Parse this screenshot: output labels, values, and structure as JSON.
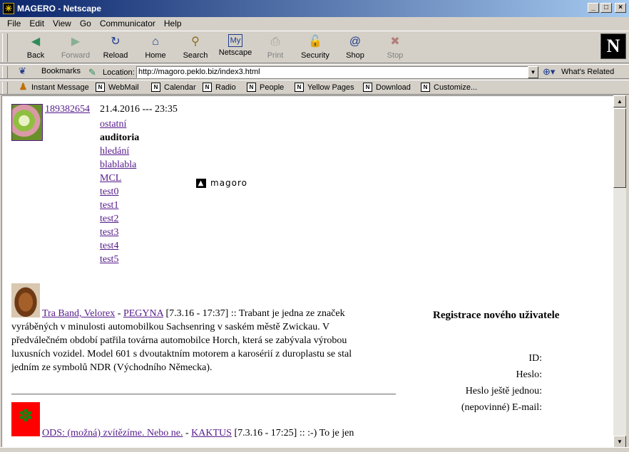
{
  "window": {
    "title": "MAGERO - Netscape",
    "buttons": {
      "minimize": "_",
      "maximize": "□",
      "close": "×"
    }
  },
  "menu": [
    "File",
    "Edit",
    "View",
    "Go",
    "Communicator",
    "Help"
  ],
  "toolbar": {
    "buttons": [
      {
        "label": "Back",
        "icon": "back-arrow-icon",
        "glyph": "◀",
        "color": "#2e8b57",
        "enabled": true
      },
      {
        "label": "Forward",
        "icon": "forward-arrow-icon",
        "glyph": "▶",
        "color": "#2e8b57",
        "enabled": false
      },
      {
        "label": "Reload",
        "icon": "reload-icon",
        "glyph": "↻",
        "color": "#1e3c8c",
        "enabled": true
      },
      {
        "label": "Home",
        "icon": "home-icon",
        "glyph": "⌂",
        "color": "#1e3c8c",
        "enabled": true
      },
      {
        "label": "Search",
        "icon": "search-icon",
        "glyph": "⚲",
        "color": "#8c6e1e",
        "enabled": true
      },
      {
        "label": "Netscape",
        "icon": "my-netscape-icon",
        "glyph": "My",
        "color": "#1e3c8c",
        "enabled": true
      },
      {
        "label": "Print",
        "icon": "print-icon",
        "glyph": "⎙",
        "color": "#555555",
        "enabled": false
      },
      {
        "label": "Security",
        "icon": "lock-icon",
        "glyph": "🔓",
        "color": "#8c1e1e",
        "enabled": true
      },
      {
        "label": "Shop",
        "icon": "shop-icon",
        "glyph": "@",
        "color": "#1e3c8c",
        "enabled": true
      },
      {
        "label": "Stop",
        "icon": "stop-icon",
        "glyph": "✖",
        "color": "#8c1e1e",
        "enabled": false
      }
    ]
  },
  "location": {
    "bookmarks_label": "Bookmarks",
    "location_label": "Location:",
    "url": "http://magoro.peklo.biz/index3.html",
    "whats_related": "What's Related"
  },
  "personal_toolbar": [
    "Instant Message",
    "WebMail",
    "Calendar",
    "Radio",
    "People",
    "Yellow Pages",
    "Download",
    "Customize..."
  ],
  "page": {
    "user": {
      "id_link": "189382654",
      "datetime": "21.4.2016 --- 23:35"
    },
    "nav_links": [
      {
        "label": "ostatní",
        "link": true
      },
      {
        "label": "auditoria",
        "link": false
      },
      {
        "label": "hledání",
        "link": true
      },
      {
        "label": "blablabla",
        "link": true
      },
      {
        "label": "MCL",
        "link": true
      },
      {
        "label": "test0",
        "link": true
      },
      {
        "label": "test1",
        "link": true
      },
      {
        "label": "test2",
        "link": true
      },
      {
        "label": "test3",
        "link": true
      },
      {
        "label": "test4",
        "link": true
      },
      {
        "label": "test5",
        "link": true
      }
    ],
    "logo_text": "magoro",
    "posts": [
      {
        "title": "Tra Band, Velorex",
        "separator": " - ",
        "author": "PEGYNA",
        "meta": " [7.3.16 - 17:37] :: Trabant je jedna ze značek",
        "lines": [
          "vyráběných v minulosti automobilkou Sachsenring v saském městě Zwickau. V",
          "předválečném období patřila továrna automobilce Horch, která se zabývala výrobou",
          "luxusních vozidel. Model 601 s dvoutaktním motorem a karosérií z duroplastu se stal",
          "jedním ze symbolů NDR (Východního Německa)."
        ]
      },
      {
        "title": "ODS: (možná) zvítězíme. Nebo ne.",
        "separator": " - ",
        "author": "KAKTUS",
        "meta": " [7.3.16 - 17:25] :: :-) To je jen"
      }
    ],
    "registration": {
      "title": "Registrace nového uživatele",
      "fields": [
        "ID:",
        "Heslo:",
        "Heslo ještě jednou:",
        "(nepovinné) E-mail:"
      ]
    }
  }
}
